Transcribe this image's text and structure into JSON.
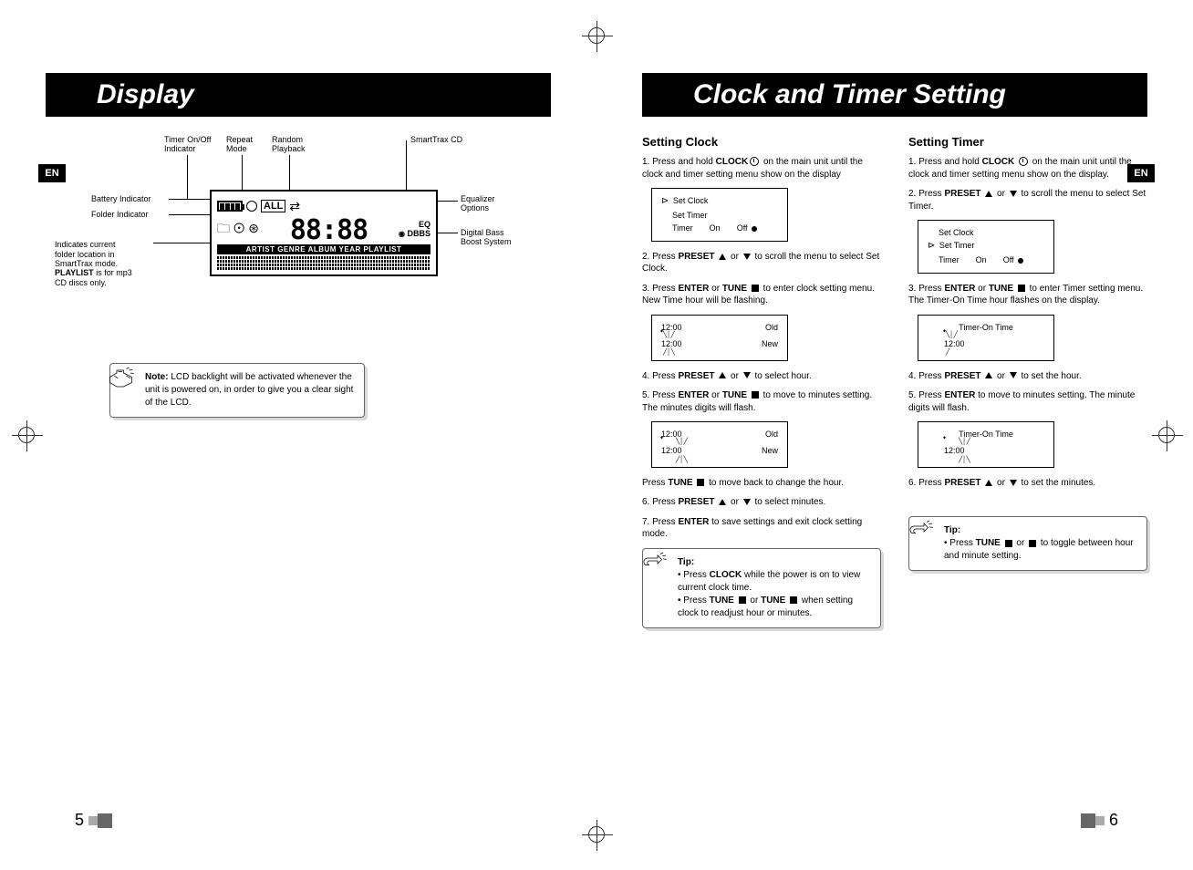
{
  "left_page": {
    "title": "Display",
    "en_badge": "EN",
    "labels": {
      "timer_indicator": "Timer On/Off\nIndicator",
      "repeat_mode": "Repeat\nMode",
      "random_playback": "Random\nPlayback",
      "smarttrax_cd": "SmartTrax CD",
      "battery_indicator": "Battery Indicator",
      "folder_indicator": "Folder Indicator",
      "equalizer_options": "Equalizer\nOptions",
      "digital_bass": "Digital Bass\nBoost System",
      "playlist_note": "Indicates current\nfolder location in\nSmartTrax mode.\n",
      "playlist_bold": "PLAYLIST",
      "playlist_note2": " is for mp3\nCD discs only."
    },
    "lcd": {
      "repeat_text": "ALL",
      "segment": "88:88",
      "eq_top": "EQ",
      "eq_bottom": "DBBS",
      "strip": "ARTIST GENRE ALBUM YEAR PLAYLIST"
    },
    "note": {
      "title": "Note:",
      "body": "LCD backlight will be activated whenever the unit is powered on, in order to give you a clear sight of the LCD."
    },
    "page_number": "5"
  },
  "right_page": {
    "title": "Clock and Timer Setting",
    "en_badge": "EN",
    "clock": {
      "heading": "Setting Clock",
      "step1_a": "1.  Press and hold ",
      "step1_b": "CLOCK",
      "step1_c": " on the main unit until the clock and timer setting menu  show on the display",
      "menu": {
        "l1": "Set Clock",
        "l2": "Set Timer",
        "l3_timer": "Timer",
        "l3_on": "On",
        "l3_off": "Off"
      },
      "step2_a": "2.  Press ",
      "step2_b": "PRESET",
      "step2_c": " or ",
      "step2_d": " to scroll the menu to select Set Clock.",
      "step3_a": "3.  Press ",
      "step3_b": "ENTER",
      "step3_c": " or ",
      "step3_d": "TUNE",
      "step3_e": " to enter clock setting menu. New Time hour will be flashing.",
      "display1": {
        "old_time": "12:00",
        "old": "Old",
        "new_time": "12:00",
        "new": "New"
      },
      "step4_a": "4.  Press ",
      "step4_b": "PRESET",
      "step4_c": " or ",
      "step4_d": " to select hour.",
      "step5_a": "5.  Press ",
      "step5_b": "ENTER",
      "step5_c": " or ",
      "step5_d": "TUNE",
      "step5_e": " to move to minutes setting.  The minutes digits will flash.",
      "display2": {
        "old_time": "12:00",
        "old": "Old",
        "new_time": "12:00",
        "new": "New"
      },
      "step_back_a": "Press ",
      "step_back_b": "TUNE",
      "step_back_c": " to move back to change the hour.",
      "step6_a": "6.  Press ",
      "step6_b": "PRESET",
      "step6_c": " or ",
      "step6_d": " to select minutes.",
      "step7_a": "7.  Press ",
      "step7_b": "ENTER",
      "step7_c": " to save settings and exit clock setting mode.",
      "tip": {
        "title": "Tip:",
        "line1_a": "•  Press ",
        "line1_b": "CLOCK",
        "line1_c": " while the power is on to view current clock time.",
        "line2_a": "•  Press ",
        "line2_b": "TUNE",
        "line2_c": " or ",
        "line2_d": "TUNE",
        "line2_e": " when setting clock to readjust hour or minutes."
      }
    },
    "timer": {
      "heading": "Setting Timer",
      "step1_a": "1. Press and hold ",
      "step1_b": "CLOCK",
      "step1_c": " on the main unit until the clock and timer setting menu show on the display.",
      "step2_a": "2.  Press ",
      "step2_b": "PRESET",
      "step2_c": " or ",
      "step2_d": " to scroll the menu to select Set Timer.",
      "menu": {
        "l1": "Set Clock",
        "l2": "Set Timer",
        "l3_timer": "Timer",
        "l3_on": "On",
        "l3_off": "Off"
      },
      "step3_a": "3.  Press ",
      "step3_b": "ENTER",
      "step3_c": " or ",
      "step3_d": "TUNE",
      "step3_e": " to enter Timer setting menu. The Timer-On Time hour flashes on the display.",
      "display1": {
        "label": "Timer-On Time",
        "time": "12:00"
      },
      "step4_a": "4.  Press ",
      "step4_b": "PRESET",
      "step4_c": " or ",
      "step4_d": " to set the hour.",
      "step5_a": "5. Press  ",
      "step5_b": "ENTER",
      "step5_c": "  to move to minutes setting. The minute digits will flash.",
      "display2": {
        "label": "Timer-On Time",
        "time": "12:00"
      },
      "step6_a": "6. Press ",
      "step6_b": "PRESET",
      "step6_c": " or ",
      "step6_d": " to set the minutes.",
      "tip": {
        "title": "Tip:",
        "line_a": "•  Press ",
        "line_b": "TUNE",
        "line_c": " or ",
        "line_d": " to toggle between hour and minute setting."
      }
    },
    "page_number": "6"
  }
}
